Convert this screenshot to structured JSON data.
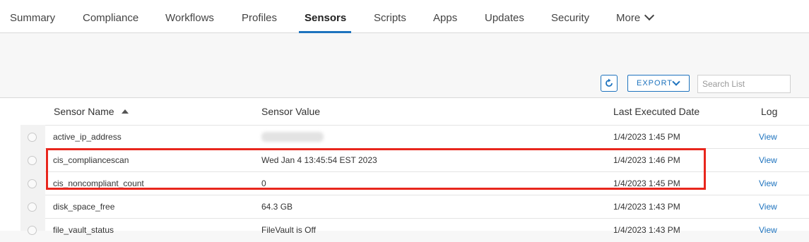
{
  "tabs": [
    {
      "label": "Summary"
    },
    {
      "label": "Compliance"
    },
    {
      "label": "Workflows"
    },
    {
      "label": "Profiles"
    },
    {
      "label": "Sensors",
      "active": true
    },
    {
      "label": "Scripts"
    },
    {
      "label": "Apps"
    },
    {
      "label": "Updates"
    },
    {
      "label": "Security"
    },
    {
      "label": "More"
    }
  ],
  "toolbar": {
    "refresh_icon": "refresh-icon",
    "export_label": "EXPORT",
    "search_placeholder": "Search List",
    "accent_color": "#1e73be"
  },
  "table": {
    "columns": {
      "name": "Sensor Name",
      "value": "Sensor Value",
      "date": "Last Executed Date",
      "log": "Log"
    },
    "sort_column": "Sensor Name",
    "sort_direction": "ascending",
    "rows": [
      {
        "name": "active_ip_address",
        "value": "",
        "value_redacted": true,
        "date": "1/4/2023 1:45 PM",
        "log": "View"
      },
      {
        "name": "cis_compliancescan",
        "value": "Wed Jan 4 13:45:54 EST 2023",
        "date": "1/4/2023 1:46 PM",
        "log": "View"
      },
      {
        "name": "cis_noncompliant_count",
        "value": "0",
        "date": "1/4/2023 1:45 PM",
        "log": "View"
      },
      {
        "name": "disk_space_free",
        "value": "64.3 GB",
        "date": "1/4/2023 1:43 PM",
        "log": "View"
      },
      {
        "name": "file_vault_status",
        "value": "FileVault is Off",
        "date": "1/4/2023 1:43 PM",
        "log": "View"
      }
    ]
  },
  "annotation": {
    "color": "#e8261d",
    "rows_highlighted": [
      "cis_compliancescan",
      "cis_noncompliant_count"
    ]
  }
}
